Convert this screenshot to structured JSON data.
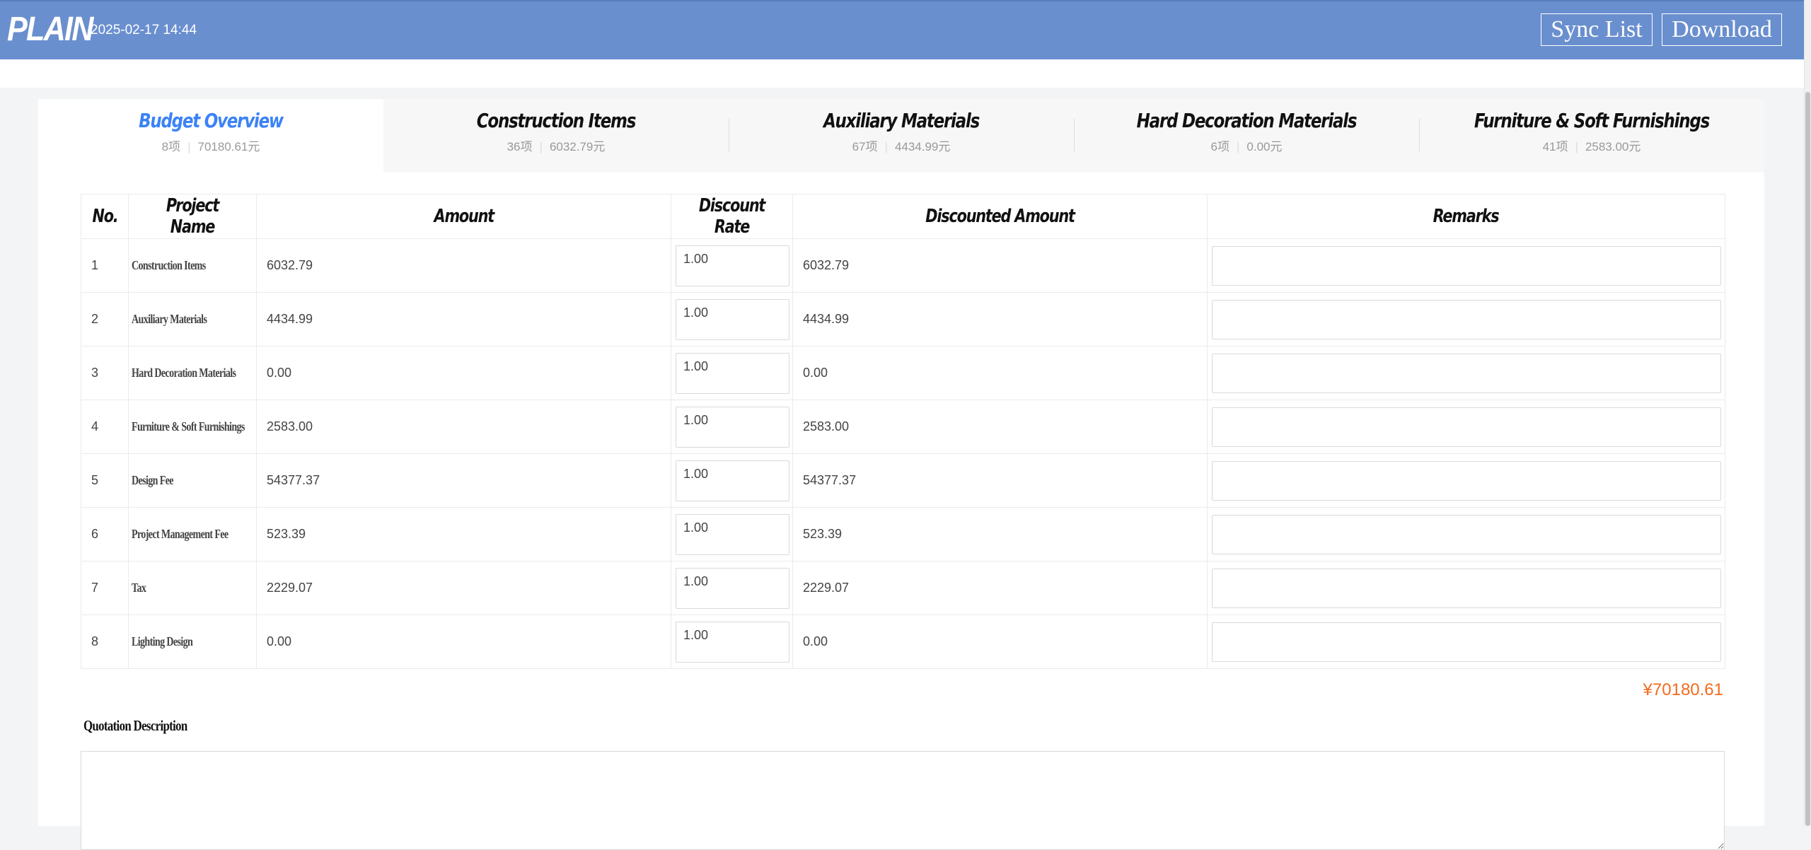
{
  "header": {
    "logo": "PLAIN",
    "timestamp": "2025-02-17 14:44",
    "sync_label": "Sync List",
    "download_label": "Download"
  },
  "tabs": [
    {
      "label": "Budget Overview",
      "count": "8项",
      "amount": "70180.61元",
      "active": true
    },
    {
      "label": "Construction Items",
      "count": "36项",
      "amount": "6032.79元",
      "active": false
    },
    {
      "label": "Auxiliary Materials",
      "count": "67项",
      "amount": "4434.99元",
      "active": false
    },
    {
      "label": "Hard Decoration Materials",
      "count": "6项",
      "amount": "0.00元",
      "active": false
    },
    {
      "label": "Furniture & Soft Furnishings",
      "count": "41项",
      "amount": "2583.00元",
      "active": false
    }
  ],
  "table": {
    "headers": {
      "no": "No.",
      "name": "Project Name",
      "amount": "Amount",
      "discount_rate": "Discount Rate",
      "discounted_amount": "Discounted Amount",
      "remarks": "Remarks"
    },
    "rows": [
      {
        "no": "1",
        "name": "Construction Items",
        "amount": "6032.79",
        "rate": "1.00",
        "discounted": "6032.79",
        "remark": ""
      },
      {
        "no": "2",
        "name": "Auxiliary Materials",
        "amount": "4434.99",
        "rate": "1.00",
        "discounted": "4434.99",
        "remark": ""
      },
      {
        "no": "3",
        "name": "Hard Decoration Materials",
        "amount": "0.00",
        "rate": "1.00",
        "discounted": "0.00",
        "remark": ""
      },
      {
        "no": "4",
        "name": "Furniture & Soft Furnishings",
        "amount": "2583.00",
        "rate": "1.00",
        "discounted": "2583.00",
        "remark": ""
      },
      {
        "no": "5",
        "name": "Design Fee",
        "amount": "54377.37",
        "rate": "1.00",
        "discounted": "54377.37",
        "remark": ""
      },
      {
        "no": "6",
        "name": "Project Management Fee",
        "amount": "523.39",
        "rate": "1.00",
        "discounted": "523.39",
        "remark": ""
      },
      {
        "no": "7",
        "name": "Tax",
        "amount": "2229.07",
        "rate": "1.00",
        "discounted": "2229.07",
        "remark": ""
      },
      {
        "no": "8",
        "name": "Lighting Design",
        "amount": "0.00",
        "rate": "1.00",
        "discounted": "0.00",
        "remark": ""
      }
    ]
  },
  "total": "¥70180.61",
  "quotation": {
    "label": "Quotation Description",
    "value": ""
  },
  "colors": {
    "header_bg": "#6a8fcf",
    "active_tab": "#3b82f6",
    "total": "#f26b1d"
  }
}
